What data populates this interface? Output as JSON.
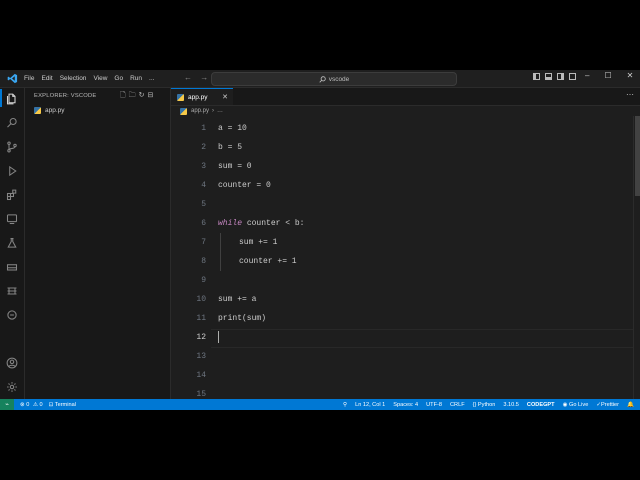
{
  "titlebar": {
    "menu": [
      "File",
      "Edit",
      "Selection",
      "View",
      "Go",
      "Run",
      "..."
    ],
    "search_text": "vscode",
    "nav_back": "←",
    "nav_forward": "→"
  },
  "sidebar": {
    "header": "EXPLORER: VSCODE",
    "files": [
      {
        "name": "app.py",
        "icon": "python-file-icon"
      }
    ]
  },
  "tabs": [
    {
      "label": "app.py",
      "active": true
    }
  ],
  "breadcrumb": {
    "file": "app.py",
    "rest": "…"
  },
  "editor": {
    "current_line": 12,
    "lines": [
      {
        "n": "1",
        "text": "a = 10"
      },
      {
        "n": "2",
        "text": "b = 5"
      },
      {
        "n": "3",
        "text": "sum = 0"
      },
      {
        "n": "4",
        "text": "counter = 0"
      },
      {
        "n": "5",
        "text": ""
      },
      {
        "n": "6",
        "kw": "while",
        "text": " counter < b:"
      },
      {
        "n": "7",
        "text": "sum += 1"
      },
      {
        "n": "8",
        "text": "counter += 1"
      },
      {
        "n": "9",
        "text": ""
      },
      {
        "n": "10",
        "text": "sum += a"
      },
      {
        "n": "11",
        "text": "print(sum)"
      },
      {
        "n": "12",
        "text": ""
      },
      {
        "n": "13",
        "text": ""
      },
      {
        "n": "14",
        "text": ""
      },
      {
        "n": "15",
        "text": ""
      }
    ]
  },
  "statusbar": {
    "remote": "⌁",
    "errors": "0",
    "warnings": "0",
    "terminal": "Terminal",
    "position": "Ln 12, Col 1",
    "spaces": "Spaces: 4",
    "encoding": "UTF-8",
    "eol": "CRLF",
    "language": "Python",
    "python_version": "3.10.5",
    "codegpt": "CODEGPT",
    "golive": "Go Live",
    "prettier": "Prettier"
  },
  "colors": {
    "accent": "#0078d4",
    "keyword": "#c586c0",
    "text": "#cccccc"
  }
}
